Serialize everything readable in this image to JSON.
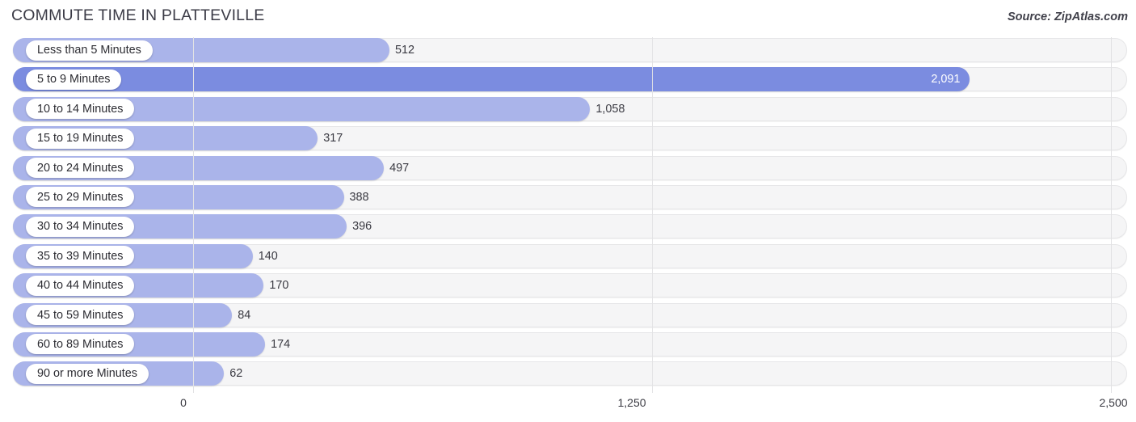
{
  "header": {
    "title": "COMMUTE TIME IN PLATTEVILLE",
    "source": "Source: ZipAtlas.com"
  },
  "colors": {
    "bar": "#aab4ea",
    "bar_highlight": "#7b8ce0",
    "track": "#f5f5f6",
    "gridline": "#e2e2e4",
    "text": "#3a3a42"
  },
  "chart_data": {
    "type": "bar",
    "orientation": "horizontal",
    "title": "COMMUTE TIME IN PLATTEVILLE",
    "xlabel": "",
    "ylabel": "",
    "xlim": [
      0,
      2500
    ],
    "grid": true,
    "legend": null,
    "xticks": [
      "0",
      "1,250",
      "2,500"
    ],
    "xtick_values": [
      0,
      1250,
      2500
    ],
    "categories": [
      "Less than 5 Minutes",
      "5 to 9 Minutes",
      "10 to 14 Minutes",
      "15 to 19 Minutes",
      "20 to 24 Minutes",
      "25 to 29 Minutes",
      "30 to 34 Minutes",
      "35 to 39 Minutes",
      "40 to 44 Minutes",
      "45 to 59 Minutes",
      "60 to 89 Minutes",
      "90 or more Minutes"
    ],
    "values": [
      512,
      2091,
      1058,
      317,
      497,
      388,
      396,
      140,
      170,
      84,
      174,
      62
    ],
    "value_labels": [
      "512",
      "2,091",
      "1,058",
      "317",
      "497",
      "388",
      "396",
      "140",
      "170",
      "84",
      "174",
      "62"
    ],
    "highlight_index": 1,
    "rows": [
      {
        "label": "Less than 5 Minutes",
        "value": 512,
        "value_label": "512",
        "highlight": false
      },
      {
        "label": "5 to 9 Minutes",
        "value": 2091,
        "value_label": "2,091",
        "highlight": true
      },
      {
        "label": "10 to 14 Minutes",
        "value": 1058,
        "value_label": "1,058",
        "highlight": false
      },
      {
        "label": "15 to 19 Minutes",
        "value": 317,
        "value_label": "317",
        "highlight": false
      },
      {
        "label": "20 to 24 Minutes",
        "value": 497,
        "value_label": "497",
        "highlight": false
      },
      {
        "label": "25 to 29 Minutes",
        "value": 388,
        "value_label": "388",
        "highlight": false
      },
      {
        "label": "30 to 34 Minutes",
        "value": 396,
        "value_label": "396",
        "highlight": false
      },
      {
        "label": "35 to 39 Minutes",
        "value": 140,
        "value_label": "140",
        "highlight": false
      },
      {
        "label": "40 to 44 Minutes",
        "value": 170,
        "value_label": "170",
        "highlight": false
      },
      {
        "label": "45 to 59 Minutes",
        "value": 84,
        "value_label": "84",
        "highlight": false
      },
      {
        "label": "60 to 89 Minutes",
        "value": 174,
        "value_label": "174",
        "highlight": false
      },
      {
        "label": "90 or more Minutes",
        "value": 62,
        "value_label": "62",
        "highlight": false
      }
    ]
  }
}
